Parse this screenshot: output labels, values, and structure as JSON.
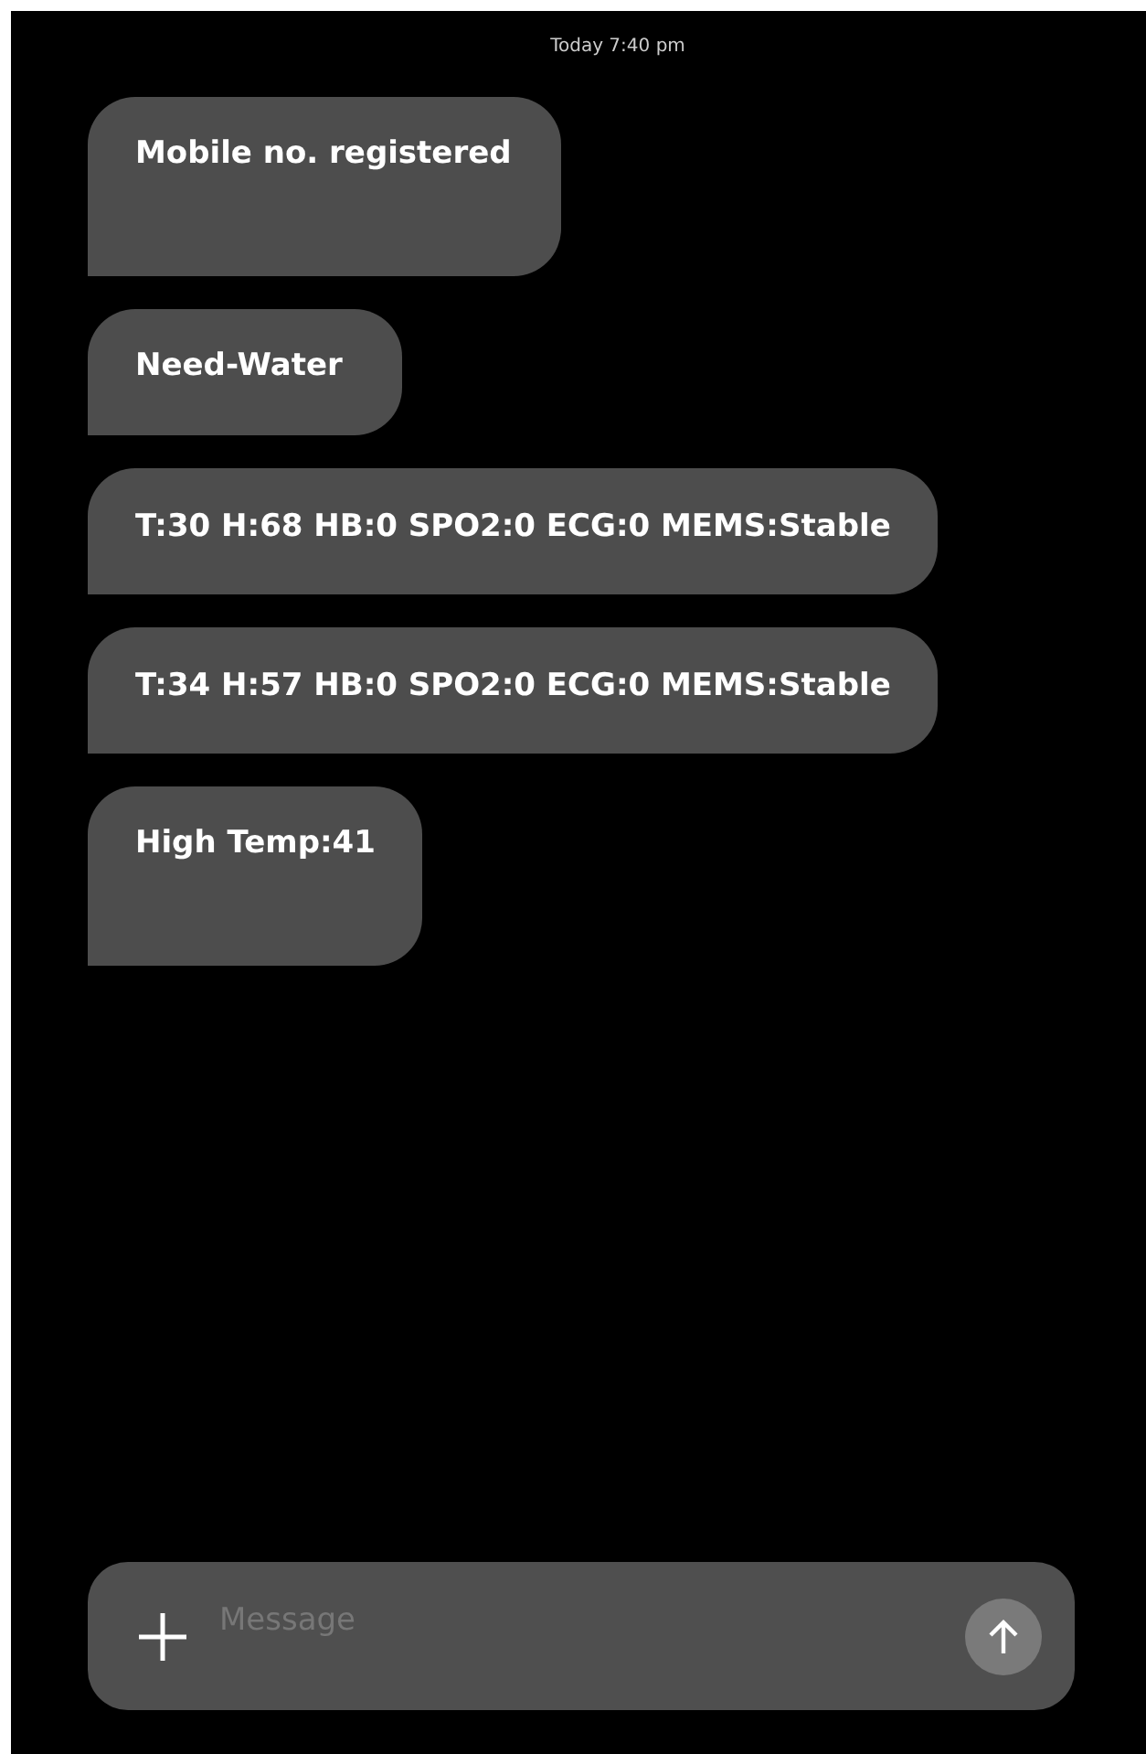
{
  "timestamp": "Today 7:40 pm",
  "messages": [
    {
      "text": "Mobile no. registered"
    },
    {
      "text": "Need-Water"
    },
    {
      "text": "T:30 H:68 HB:0 SPO2:0 ECG:0 MEMS:Stable"
    },
    {
      "text": "T:34 H:57 HB:0 SPO2:0 ECG:0 MEMS:Stable"
    },
    {
      "text": "High Temp:41"
    }
  ],
  "composer": {
    "placeholder": "Message"
  }
}
